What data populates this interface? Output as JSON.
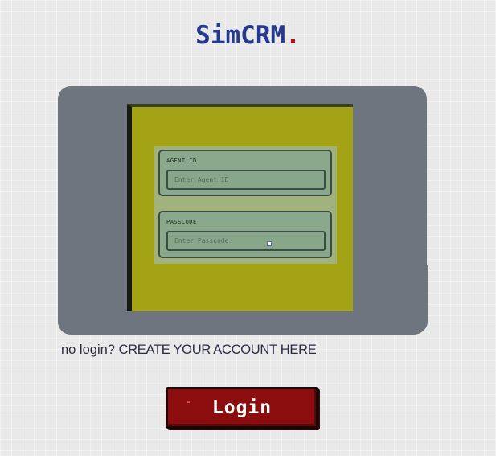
{
  "brand": {
    "name": "SimCRM",
    "dot": "."
  },
  "login_form": {
    "agent_id": {
      "label": "AGENT ID",
      "placeholder": "Enter Agent ID",
      "value": ""
    },
    "passcode": {
      "label": "PASSCODE",
      "placeholder": "Enter Passcode",
      "value": ""
    }
  },
  "signup": {
    "prefix": "no login?",
    "link_label": "CREATE YOUR ACCOUNT HERE"
  },
  "login_button": {
    "label": "Login"
  },
  "colors": {
    "brand_text": "#253a8e",
    "brand_dot": "#b3121a",
    "console": "#6f757e",
    "screen": "#a4a316",
    "form_panel": "#a2b27c",
    "field": "#8aa98c",
    "button": "#8b0d0d"
  }
}
